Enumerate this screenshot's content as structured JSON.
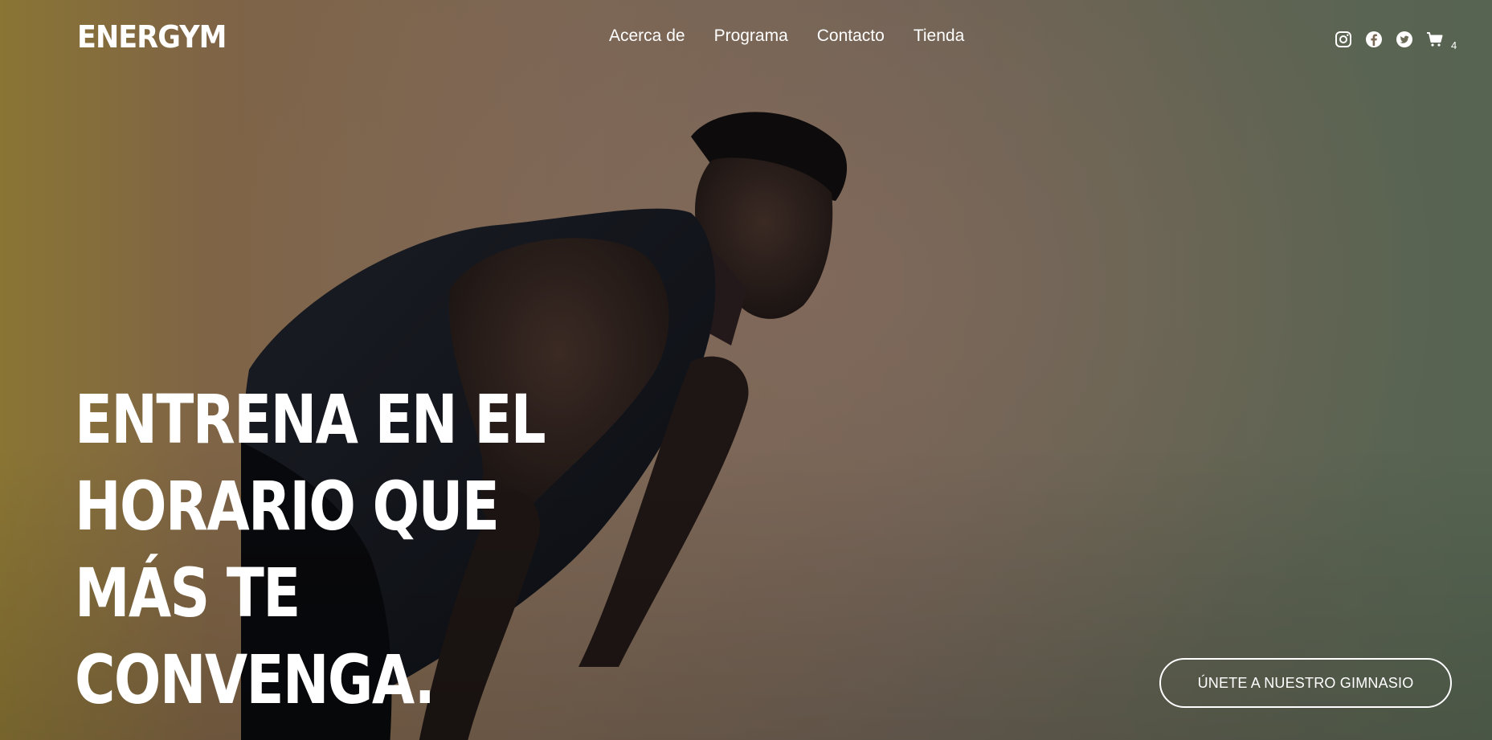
{
  "brand": {
    "logo": "ENERGYM"
  },
  "nav": {
    "items": [
      {
        "label": "Acerca de"
      },
      {
        "label": "Programa"
      },
      {
        "label": "Contacto"
      },
      {
        "label": "Tienda"
      }
    ]
  },
  "social": {
    "icons": [
      "instagram-icon",
      "facebook-icon",
      "twitter-icon",
      "cart-icon"
    ],
    "cart_count": "4"
  },
  "hero": {
    "headline_lines": [
      "ENTRENA EN EL",
      "HORARIO QUE",
      "MÁS TE",
      "CONVENGA."
    ],
    "cta_label": "ÚNETE A NUESTRO GIMNASIO"
  },
  "colors": {
    "text": "#ffffff",
    "bg_left": "#8a7534",
    "bg_center": "#7b6552",
    "bg_right": "#566451"
  }
}
